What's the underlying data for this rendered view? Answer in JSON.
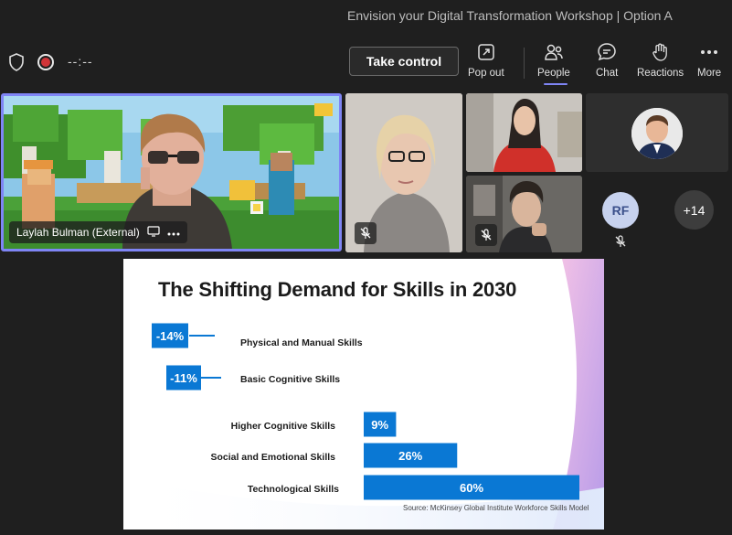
{
  "window": {
    "title": "Envision your Digital Transformation Workshop | Option A"
  },
  "toolbar": {
    "timer": "--:--",
    "take_control": "Take control",
    "pop_out": "Pop out",
    "people": "People",
    "chat": "Chat",
    "reactions": "Reactions",
    "more": "More"
  },
  "participants": {
    "main_name": "Laylah Bulman (External)",
    "initials": "RF",
    "overflow": "+14"
  },
  "slide": {
    "title": "The Shifting Demand for Skills in 2030",
    "source": "Source: McKinsey Global Institute Workforce Skills Model"
  },
  "chart_data": {
    "type": "bar",
    "orientation": "horizontal",
    "title": "The Shifting Demand for Skills in 2030",
    "categories": [
      "Physical and Manual Skills",
      "Basic Cognitive Skills",
      "Higher Cognitive Skills",
      "Social and Emotional Skills",
      "Technological Skills"
    ],
    "values": [
      -14,
      -11,
      9,
      26,
      60
    ],
    "labels": [
      "-14%",
      "-11%",
      "9%",
      "26%",
      "60%"
    ],
    "color": "#0a78d4"
  },
  "colors": {
    "accent": "#7f85f5",
    "bar": "#0a78d4",
    "record": "#d13438"
  }
}
